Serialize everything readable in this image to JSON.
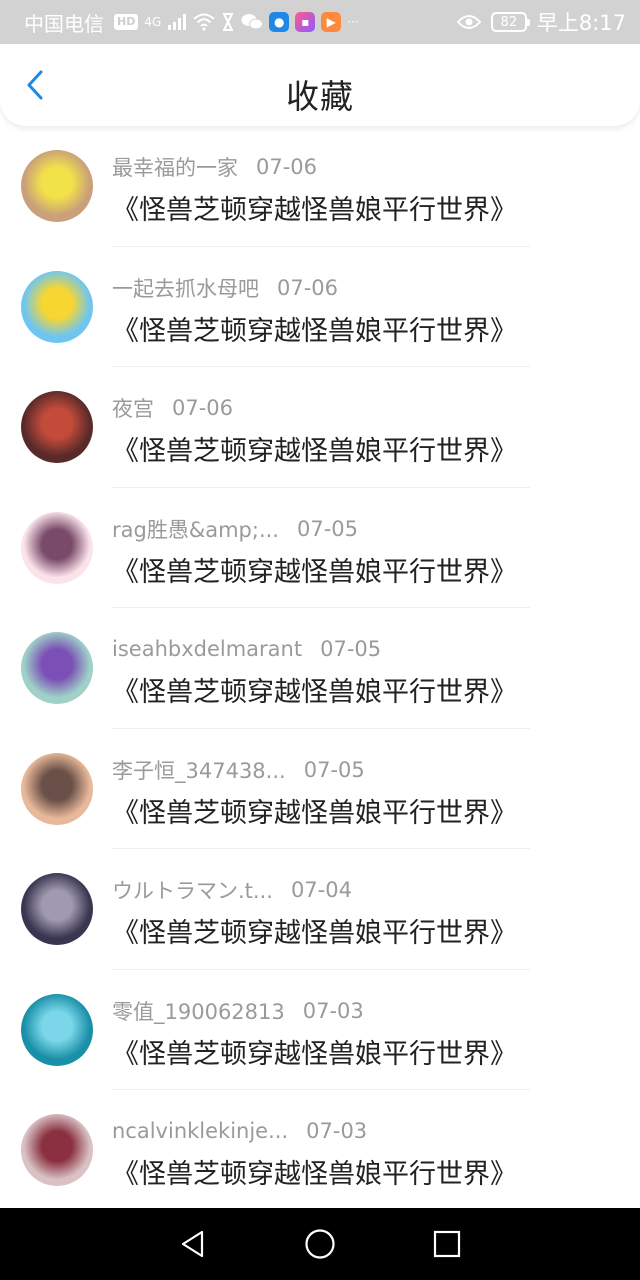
{
  "status_bar": {
    "carrier": "中国电信",
    "hd": "HD",
    "network": "4G",
    "more": "···",
    "battery": "82",
    "time": "早上8:17",
    "icons": [
      "signal-icon",
      "wifi-icon",
      "hourglass-icon",
      "wechat-icon",
      "app-icon",
      "app-icon",
      "app-icon",
      "eye-icon",
      "battery-icon"
    ]
  },
  "header": {
    "title": "收藏",
    "back_icon": "chevron-left-icon",
    "accent_color": "#1e88e5"
  },
  "favorites": [
    {
      "user": "最幸福的一家",
      "date": "07-06",
      "title": "《怪兽芝顿穿越怪兽娘平行世界》",
      "avatar_colors": [
        "#c9a07a",
        "#f2e24a"
      ]
    },
    {
      "user": "一起去抓水母吧",
      "date": "07-06",
      "title": "《怪兽芝顿穿越怪兽娘平行世界》",
      "avatar_colors": [
        "#6ec6f0",
        "#f7d631"
      ]
    },
    {
      "user": "夜宫",
      "date": "07-06",
      "title": "《怪兽芝顿穿越怪兽娘平行世界》",
      "avatar_colors": [
        "#5a2a2a",
        "#c24b3a"
      ]
    },
    {
      "user": "rag胜愚&amp;...",
      "date": "07-05",
      "title": "《怪兽芝顿穿越怪兽娘平行世界》",
      "avatar_colors": [
        "#fbe3ea",
        "#7a4a6a"
      ]
    },
    {
      "user": "iseahbxdelmarant",
      "date": "07-05",
      "title": "《怪兽芝顿穿越怪兽娘平行世界》",
      "avatar_colors": [
        "#9fd1c8",
        "#7b4fb5"
      ]
    },
    {
      "user": "李子恒_347438...",
      "date": "07-05",
      "title": "《怪兽芝顿穿越怪兽娘平行世界》",
      "avatar_colors": [
        "#e8b89a",
        "#6a5048"
      ]
    },
    {
      "user": "ウルトラマン.t...",
      "date": "07-04",
      "title": "《怪兽芝顿穿越怪兽娘平行世界》",
      "avatar_colors": [
        "#3a3550",
        "#a09ab0"
      ]
    },
    {
      "user": "零值_190062813",
      "date": "07-03",
      "title": "《怪兽芝顿穿越怪兽娘平行世界》",
      "avatar_colors": [
        "#1a8fa8",
        "#7ad6e8"
      ]
    },
    {
      "user": "ncalvinklekinje...",
      "date": "07-03",
      "title": "《怪兽芝顿穿越怪兽娘平行世界》",
      "avatar_colors": [
        "#d9c1c4",
        "#8a3040"
      ]
    }
  ],
  "system_nav": {
    "back": "triangle-back-icon",
    "home": "circle-home-icon",
    "recents": "square-recents-icon"
  }
}
